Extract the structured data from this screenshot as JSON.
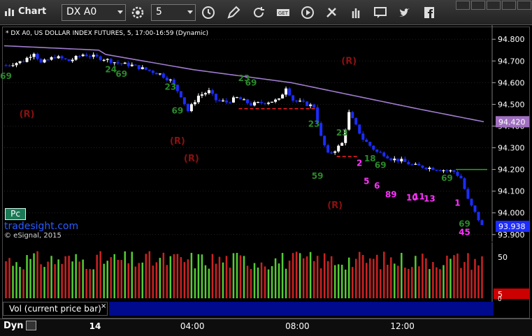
{
  "toolbar": {
    "title": "Chart",
    "symbol": "DX A0",
    "interval": "5",
    "icons": [
      "chart-icon",
      "gear-icon",
      "clock-icon",
      "pencil-icon",
      "refresh-icon",
      "get-icon",
      "play-icon",
      "tools-icon",
      "chat-icon",
      "twitter-icon",
      "facebook-icon"
    ]
  },
  "header": "* DX A0, US DOLLAR INDEX FUTURES, 5, 17:00-16:59 (Dynamic)",
  "badge": "Pc",
  "watermark": {
    "site": "tradesight.com",
    "copyright": "© eSignal, 2015"
  },
  "volume": {
    "label": "Vol (current price bar)",
    "close": "×",
    "axis_label": "50",
    "axis_zero": "0",
    "current": "5"
  },
  "bottom": {
    "dyn": "Dyn"
  },
  "colors": {
    "up": "#ffffff",
    "down": "#1c2cff",
    "ma": "#a07cd0",
    "last_price_bg": "#1c2cff",
    "vol_up": "#55cc33",
    "vol_down": "#cc2222",
    "r_label": "#8b1010"
  },
  "chart_data": {
    "type": "candlestick",
    "ylim": [
      93.88,
      94.82
    ],
    "y_ticks": [
      "94.800",
      "94.700",
      "94.600",
      "94.500",
      "94.400",
      "94.300",
      "94.200",
      "94.100",
      "94.000",
      "93.900"
    ],
    "x_ticks": [
      {
        "label": "14",
        "bar": 25
      },
      {
        "label": "04:00",
        "bar": 53
      },
      {
        "label": "08:00",
        "bar": 83
      },
      {
        "label": "12:00",
        "bar": 113
      }
    ],
    "num_bars": 137,
    "last_price": "94.420",
    "current_price": "93.938",
    "anchors": [
      [
        0,
        94.68
      ],
      [
        5,
        94.7
      ],
      [
        8,
        94.74
      ],
      [
        10,
        94.69
      ],
      [
        14,
        94.72
      ],
      [
        18,
        94.7
      ],
      [
        22,
        94.73
      ],
      [
        25,
        94.72
      ],
      [
        28,
        94.71
      ],
      [
        32,
        94.69
      ],
      [
        36,
        94.68
      ],
      [
        40,
        94.66
      ],
      [
        44,
        94.64
      ],
      [
        47,
        94.61
      ],
      [
        50,
        94.54
      ],
      [
        52,
        94.47
      ],
      [
        55,
        94.54
      ],
      [
        58,
        94.56
      ],
      [
        60,
        94.52
      ],
      [
        63,
        94.51
      ],
      [
        66,
        94.53
      ],
      [
        70,
        94.5
      ],
      [
        74,
        94.51
      ],
      [
        78,
        94.52
      ],
      [
        80,
        94.58
      ],
      [
        82,
        94.52
      ],
      [
        86,
        94.5
      ],
      [
        88,
        94.49
      ],
      [
        90,
        94.35
      ],
      [
        92,
        94.27
      ],
      [
        94,
        94.29
      ],
      [
        96,
        94.32
      ],
      [
        98,
        94.46
      ],
      [
        100,
        94.4
      ],
      [
        102,
        94.34
      ],
      [
        104,
        94.31
      ],
      [
        106,
        94.28
      ],
      [
        108,
        94.27
      ],
      [
        110,
        94.25
      ],
      [
        113,
        94.24
      ],
      [
        116,
        94.22
      ],
      [
        120,
        94.21
      ],
      [
        124,
        94.2
      ],
      [
        128,
        94.19
      ],
      [
        130,
        94.16
      ],
      [
        132,
        94.06
      ],
      [
        134,
        94.0
      ],
      [
        136,
        93.94
      ]
    ],
    "moving_average": [
      [
        0,
        94.77
      ],
      [
        27,
        94.75
      ],
      [
        29,
        94.73
      ],
      [
        54,
        94.66
      ],
      [
        82,
        94.6
      ],
      [
        100,
        94.54
      ],
      [
        118,
        94.48
      ],
      [
        137,
        94.42
      ]
    ],
    "reference_lines": [
      {
        "price": 94.48,
        "bar_from": 67,
        "bar_to": 89,
        "color": "#ff2020"
      },
      {
        "price": 94.26,
        "bar_from": 95,
        "bar_to": 101,
        "color": "#ff2020"
      },
      {
        "price": 94.2,
        "bar_from": 129,
        "bar_to": 138,
        "color": "#22aa22"
      }
    ],
    "annotations": [
      {
        "text": "(R)",
        "bar": 6,
        "price": 94.455,
        "color": "#8b1010"
      },
      {
        "text": "(R)",
        "bar": 49,
        "price": 94.33,
        "color": "#8b1010"
      },
      {
        "text": "(R)",
        "bar": 53,
        "price": 94.25,
        "color": "#8b1010"
      },
      {
        "text": "(R)",
        "bar": 98,
        "price": 94.7,
        "color": "#8b1010"
      },
      {
        "text": "(R)",
        "bar": 94,
        "price": 94.035,
        "color": "#8b1010"
      },
      {
        "text": "2",
        "bar": 101,
        "price": 94.23,
        "color": "#ff33ff"
      },
      {
        "text": "5",
        "bar": 103,
        "price": 94.145,
        "color": "#ff33ff"
      },
      {
        "text": "6",
        "bar": 106,
        "price": 94.125,
        "color": "#ff33ff"
      },
      {
        "text": "89",
        "bar": 110,
        "price": 94.085,
        "color": "#ff33ff"
      },
      {
        "text": "10",
        "bar": 116,
        "price": 94.07,
        "color": "#ff33ff"
      },
      {
        "text": "11",
        "bar": 118,
        "price": 94.075,
        "color": "#ff33ff"
      },
      {
        "text": "13",
        "bar": 121,
        "price": 94.065,
        "color": "#ff33ff"
      },
      {
        "text": "1",
        "bar": 129,
        "price": 94.045,
        "color": "#ff33ff"
      },
      {
        "text": "45",
        "bar": 131,
        "price": 93.91,
        "color": "#ff33ff"
      },
      {
        "text": "69",
        "bar": 0,
        "price": 94.63,
        "color": "#2a8a2a"
      },
      {
        "text": "24",
        "bar": 30,
        "price": 94.66,
        "color": "#2a8a2a"
      },
      {
        "text": "69",
        "bar": 33,
        "price": 94.64,
        "color": "#2a8a2a"
      },
      {
        "text": "23",
        "bar": 47,
        "price": 94.58,
        "color": "#2a8a2a"
      },
      {
        "text": "69",
        "bar": 49,
        "price": 94.47,
        "color": "#2a8a2a"
      },
      {
        "text": "23",
        "bar": 68,
        "price": 94.62,
        "color": "#2a8a2a"
      },
      {
        "text": "69",
        "bar": 70,
        "price": 94.6,
        "color": "#2a8a2a"
      },
      {
        "text": "23",
        "bar": 88,
        "price": 94.41,
        "color": "#2a8a2a"
      },
      {
        "text": "59",
        "bar": 89,
        "price": 94.17,
        "color": "#2a8a2a"
      },
      {
        "text": "23",
        "bar": 96,
        "price": 94.37,
        "color": "#2a8a2a"
      },
      {
        "text": "18",
        "bar": 104,
        "price": 94.25,
        "color": "#2a8a2a"
      },
      {
        "text": "69",
        "bar": 107,
        "price": 94.22,
        "color": "#2a8a2a"
      },
      {
        "text": "69",
        "bar": 126,
        "price": 94.16,
        "color": "#2a8a2a"
      },
      {
        "text": "69",
        "bar": 131,
        "price": 93.95,
        "color": "#2a8a2a"
      }
    ]
  }
}
